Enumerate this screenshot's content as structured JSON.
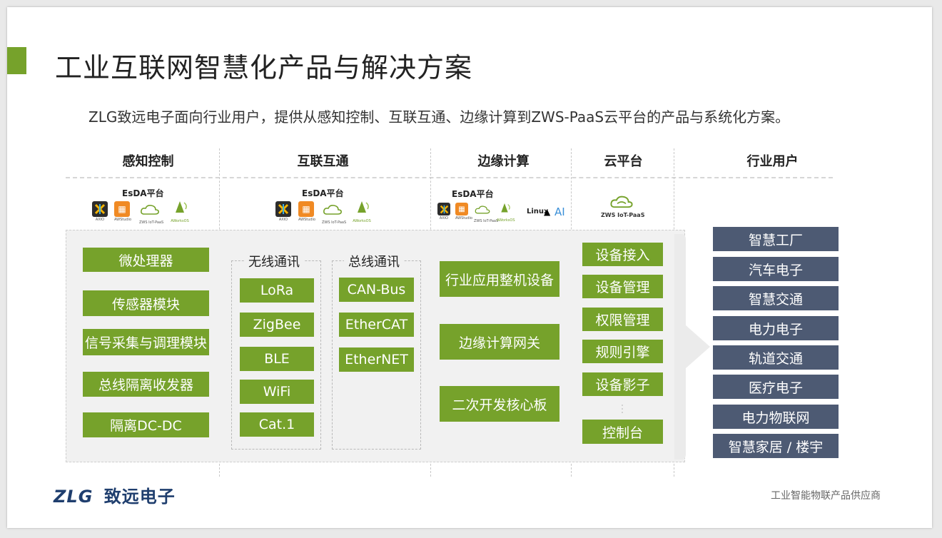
{
  "title": "工业互联网智慧化产品与解决方案",
  "subtitle": "ZLG致远电子面向行业用户，提供从感知控制、互联互通、边缘计算到ZWS-PaaS云平台的产品与系统化方案。",
  "columns": [
    "感知控制",
    "互联互通",
    "边缘计算",
    "云平台",
    "行业用户"
  ],
  "esda_label": "EsDA平台",
  "logos": {
    "axio": "AXIO",
    "awstudio": "AWStudio",
    "zws": "ZWS IoT-PaaS",
    "os": "AWorksOS",
    "linux": "Linux",
    "ai": "AI"
  },
  "sensing": [
    "微处理器",
    "传感器模块",
    "信号采集与调理模块",
    "总线隔离收发器",
    "隔离DC-DC"
  ],
  "wireless": {
    "label": "无线通讯",
    "items": [
      "LoRa",
      "ZigBee",
      "BLE",
      "WiFi",
      "Cat.1"
    ]
  },
  "bus": {
    "label": "总线通讯",
    "items": [
      "CAN-Bus",
      "EtherCAT",
      "EtherNET"
    ]
  },
  "edge": [
    "行业应用整机设备",
    "边缘计算网关",
    "二次开发核心板"
  ],
  "cloud": [
    "设备接入",
    "设备管理",
    "权限管理",
    "规则引擎",
    "设备影子",
    "控制台"
  ],
  "industries": [
    "智慧工厂",
    "汽车电子",
    "智慧交通",
    "电力电子",
    "轨道交通",
    "医疗电子",
    "电力物联网",
    "智慧家居 / 楼宇"
  ],
  "footer": {
    "brand_latin": "ZLG",
    "brand_cn": "致远电子",
    "tagline": "工业智能物联产品供应商"
  },
  "colors": {
    "accent_green": "#76a22b",
    "industry_blue": "#4d5a73",
    "brand_blue": "#1f3e6e"
  }
}
